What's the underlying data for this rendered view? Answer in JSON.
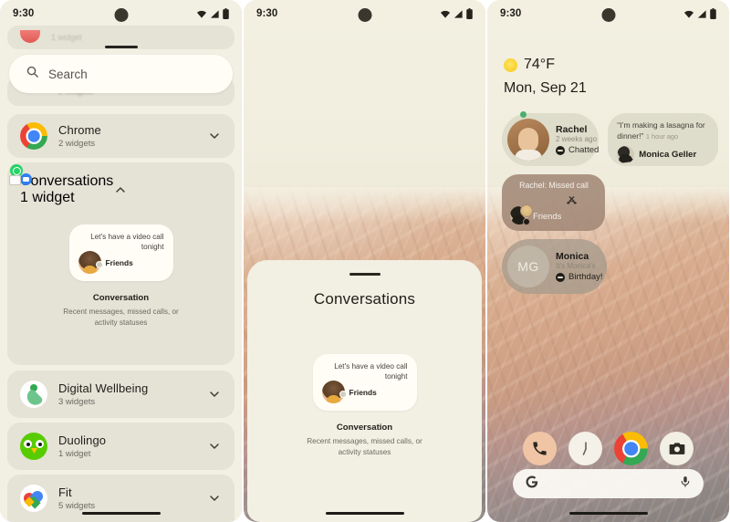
{
  "statusbar": {
    "time": "9:30",
    "wifi_icon": "wifi-icon",
    "signal_icon": "signal-icon",
    "battery_icon": "battery-icon",
    "camera_icon": "front-camera-dot"
  },
  "panel1": {
    "partial_row": {
      "sub": "1 widget"
    },
    "search": {
      "placeholder": "Search",
      "icon": "search-icon"
    },
    "blurred_row": {
      "sub": "2 widgets"
    },
    "apps": [
      {
        "name": "Chrome",
        "sub": "2 widgets",
        "icon": "chrome-icon",
        "chevron": "chevron-down-icon",
        "expanded": false
      },
      {
        "name": "Conversations",
        "sub": "1 widget",
        "icon": "conversations-icon",
        "chevron": "chevron-up-icon",
        "expanded": true
      },
      {
        "name": "Digital Wellbeing",
        "sub": "3 widgets",
        "icon": "digital-wellbeing-icon",
        "chevron": "chevron-down-icon",
        "expanded": false
      },
      {
        "name": "Duolingo",
        "sub": "1 widget",
        "icon": "duolingo-icon",
        "chevron": "chevron-down-icon",
        "expanded": false
      },
      {
        "name": "Fit",
        "sub": "5 widgets",
        "icon": "fit-icon",
        "chevron": "chevron-down-icon",
        "expanded": false
      }
    ],
    "widget_preview": {
      "message": "Let's have a video call tonight",
      "contact": "Friends",
      "title": "Conversation",
      "description": "Recent messages, missed calls, or activity statuses"
    }
  },
  "panel2": {
    "sheet_title": "Conversations",
    "widget_preview": {
      "message": "Let's have a video call tonight",
      "contact": "Friends",
      "title": "Conversation",
      "description": "Recent messages, missed calls, or activity statuses"
    }
  },
  "panel3": {
    "weather": {
      "temp": "74°F",
      "icon": "sun-icon"
    },
    "date": "Mon, Sep 21",
    "bubbles": {
      "rachel": {
        "name": "Rachel",
        "time": "2 weeks ago",
        "status": "Chatted",
        "badge": "message-badge-icon"
      },
      "monica_quote": {
        "quote": "“I’m making a lasagna for dinner!”",
        "time": "1 hour ago",
        "name": "Monica Geller",
        "presence": "online-dot"
      },
      "missed_call": {
        "title": "Rachel: Missed call",
        "label": "Friends",
        "icon": "missed-call-icon"
      },
      "birthday": {
        "initials": "MG",
        "name": "Monica",
        "line1": "It’s Monica’s",
        "line2": "Birthday!",
        "badge": "message-badge-icon"
      }
    },
    "dock": [
      {
        "name": "Phone",
        "icon": "phone-icon"
      },
      {
        "name": "Clock",
        "icon": "clock-icon"
      },
      {
        "name": "Chrome",
        "icon": "chrome-icon"
      },
      {
        "name": "Camera",
        "icon": "camera-icon"
      }
    ],
    "search": {
      "logo": "google-g-icon",
      "mic": "microphone-icon"
    }
  }
}
